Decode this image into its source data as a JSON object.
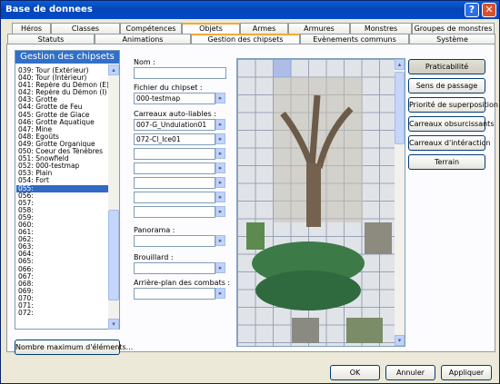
{
  "window": {
    "title": "Base de donnees",
    "help_label": "?",
    "close_label": "✕"
  },
  "tabs_row1": [
    "Héros",
    "Classes",
    "Compétences",
    "Objets",
    "Armes",
    "Armures",
    "Monstres",
    "Groupes de monstres"
  ],
  "tabs_row2": [
    "Statuts",
    "Animations",
    "Gestion des chipsets",
    "Evènements communs",
    "Système"
  ],
  "list": {
    "header": "Gestion des chipsets",
    "items": [
      "039: Tour (Extérieur)",
      "040: Tour (Intérieur)",
      "041: Repère du Démon (E)",
      "042: Repère du Démon (I)",
      "043: Grotte",
      "044: Grotte de Feu",
      "045: Grotte de Glace",
      "046: Grotte Aquatique",
      "047: Mine",
      "048: Egoûts",
      "049: Grotte Organique",
      "050: Coeur des Ténèbres",
      "051: Snowfield",
      "052: 000-testmap",
      "053: Plain",
      "054: Fort",
      "055:",
      "056:",
      "057:",
      "058:",
      "059:",
      "060:",
      "061:",
      "062:",
      "063:",
      "064:",
      "065:",
      "066:",
      "067:",
      "068:",
      "069:",
      "070:",
      "071:",
      "072:"
    ],
    "selected": "055:",
    "max_button": "Nombre maximum d'éléments..."
  },
  "form": {
    "name_label": "Nom :",
    "name_value": "",
    "file_label": "Fichier du chipset :",
    "file_value": "000-testmap",
    "autotiles_label": "Carreaux auto-liables :",
    "autotiles": [
      "007-G_Undulation01",
      "072-Cl_Ice01",
      "",
      "",
      "",
      "",
      ""
    ],
    "panorama_label": "Panorama :",
    "panorama_value": "",
    "fog_label": "Brouillard :",
    "fog_value": "",
    "battleback_label": "Arrière-plan des combats :",
    "battleback_value": ""
  },
  "side_buttons": [
    "Praticabilité",
    "Sens de passage",
    "Priorité de superposition",
    "Carreaux obsurcissants",
    "Carreaux d'intéraction",
    "Terrain"
  ],
  "active_side_button": "Praticabilité",
  "footer": {
    "ok": "OK",
    "cancel": "Annuler",
    "apply": "Appliquer"
  },
  "icons": {
    "arrow": "▸",
    "scroll_up": "▴",
    "scroll_down": "▾"
  }
}
